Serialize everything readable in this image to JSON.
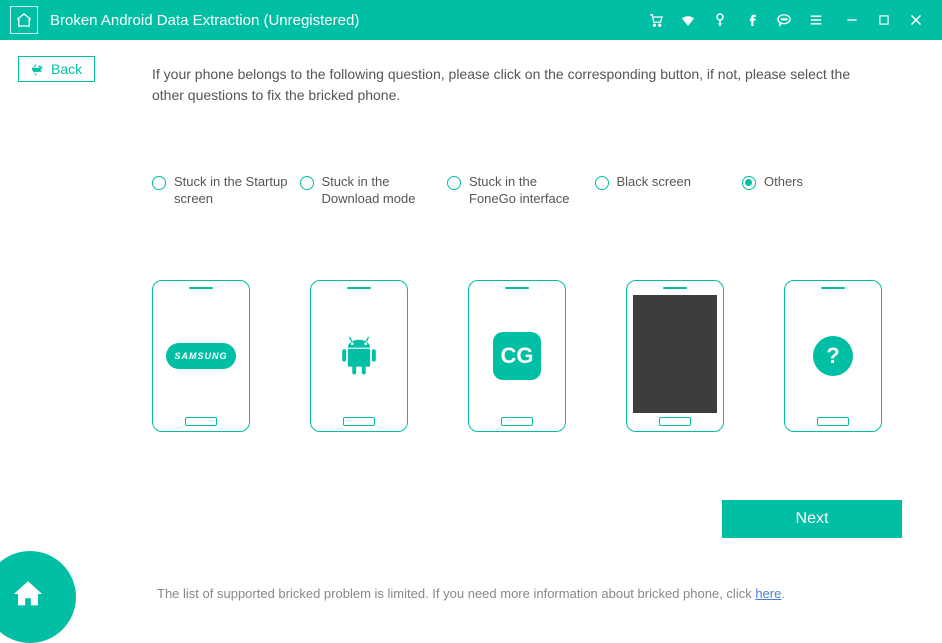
{
  "titlebar": {
    "title": "Broken Android Data Extraction (Unregistered)"
  },
  "back_label": "Back",
  "instruction": "If your phone belongs to the following question, please click on the corresponding button, if not, please select the other questions to fix the bricked phone.",
  "options": [
    {
      "label": "Stuck in the Startup screen",
      "selected": false
    },
    {
      "label": "Stuck in the Download mode",
      "selected": false
    },
    {
      "label": "Stuck in the FoneGo interface",
      "selected": false
    },
    {
      "label": "Black screen",
      "selected": false
    },
    {
      "label": "Others",
      "selected": true
    }
  ],
  "phone_icons": {
    "samsung_text": "SAMSUNG",
    "fonego_text": "CG",
    "question_text": "?"
  },
  "next_label": "Next",
  "footer": {
    "text_before": "The list of supported bricked problem is limited. If you need more information about bricked phone, click ",
    "link_text": "here",
    "text_after": "."
  },
  "colors": {
    "primary": "#00bfa5"
  }
}
